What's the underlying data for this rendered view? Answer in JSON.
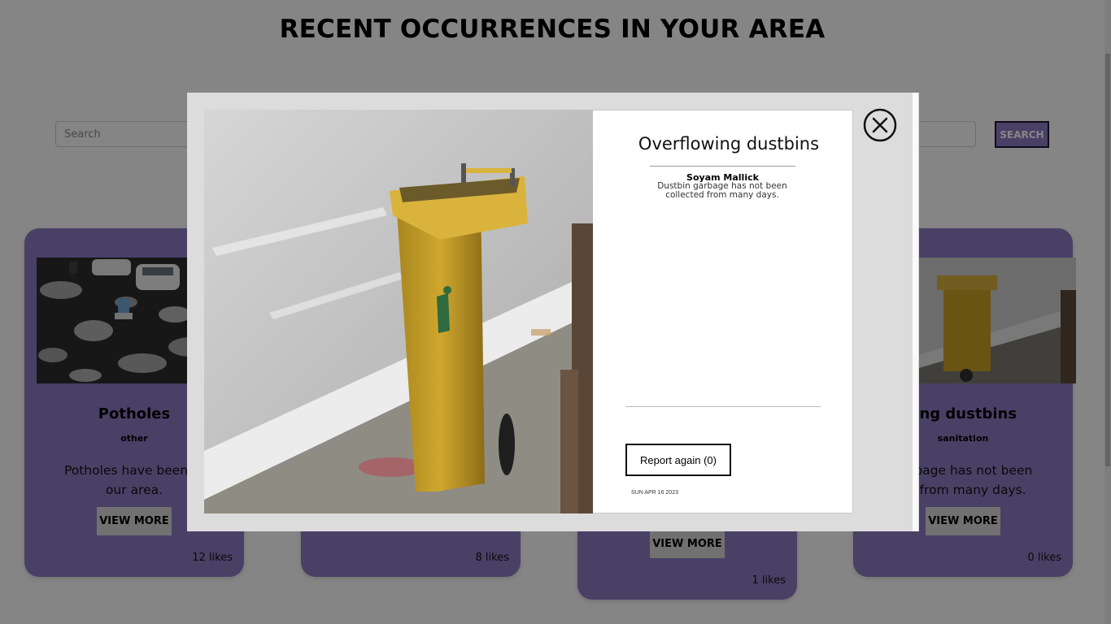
{
  "page": {
    "title": "RECENT OCCURRENCES IN YOUR AREA"
  },
  "search": {
    "placeholder": "Search",
    "button_label": "SEARCH"
  },
  "cards": [
    {
      "title": "Potholes",
      "category": "other",
      "desc_lines": [
        "Potholes have been fo",
        "our area."
      ],
      "view_label": "VIEW MORE",
      "likes": "12 likes"
    },
    {
      "view_label": "",
      "likes": "8 likes"
    },
    {
      "view_label": "VIEW MORE",
      "likes": "1 likes"
    },
    {
      "title": "flowing dustbins",
      "category": "sanitation",
      "desc_lines": [
        "garbage has not been",
        "ed from many days."
      ],
      "view_label": "VIEW MORE",
      "likes": "0 likes"
    }
  ],
  "modal": {
    "title": "Overflowing dustbins",
    "author": "Soyam Mallick",
    "desc_lines": [
      "Dustbin garbage has not been",
      "collected from many days."
    ],
    "report_label": "Report again (0)",
    "date": "SUN APR 16 2023"
  },
  "icons": {
    "close": "close-circle-icon",
    "dustbin_photo": "dustbin-photo",
    "pothole_photo": "pothole-photo"
  },
  "colors": {
    "card_purple": "#8e7cc3",
    "overlay": "#7a7a7a",
    "modal_panel": "#dcdcdc"
  }
}
